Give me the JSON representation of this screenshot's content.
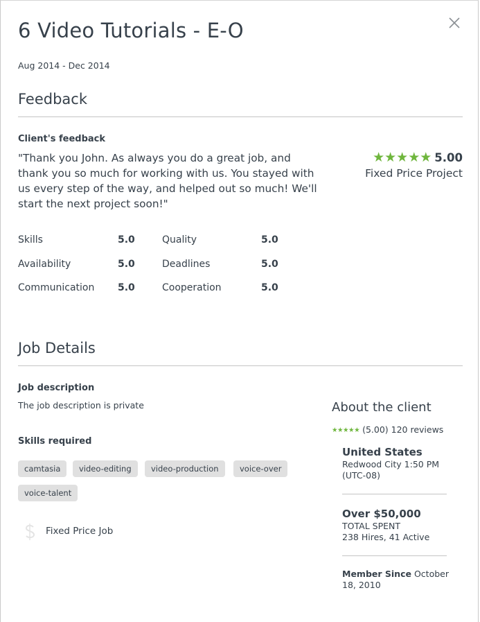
{
  "header": {
    "title": "6 Video Tutorials - E-O",
    "dates": "Aug 2014 - Dec 2014"
  },
  "feedback": {
    "section_title": "Feedback",
    "client_feedback_label": "Client's feedback",
    "quote": "\"Thank you John. As always you do a great job, and thank you so much for working with us. You stayed with us every step of the way, and helped out so much! We'll start the next project soon!\"",
    "stars": "★★★★★",
    "overall_score": "5.00",
    "rating_value": 5.0,
    "contract_type": "Fixed Price Project",
    "metrics": [
      {
        "label": "Skills",
        "value": "5.0"
      },
      {
        "label": "Quality",
        "value": "5.0"
      },
      {
        "label": "Availability",
        "value": "5.0"
      },
      {
        "label": "Deadlines",
        "value": "5.0"
      },
      {
        "label": "Communication",
        "value": "5.0"
      },
      {
        "label": "Cooperation",
        "value": "5.0"
      }
    ]
  },
  "job_details": {
    "section_title": "Job Details",
    "description_label": "Job description",
    "description": "The job description is private",
    "skills_label": "Skills required",
    "skills": [
      "camtasia",
      "video-editing",
      "video-production",
      "voice-over",
      "voice-talent"
    ],
    "job_type": "Fixed Price Job"
  },
  "about_client": {
    "title": "About the client",
    "stars": "★★★★★",
    "rating": "(5.00) 120 reviews",
    "location": "United States",
    "city_time": "Redwood City 1:50 PM",
    "timezone": "(UTC-08)",
    "spent": "Over $50,000",
    "spent_label": "TOTAL SPENT",
    "hires": "238 Hires, 41 Active",
    "member_since_label": "Member Since",
    "member_since": "October 18, 2010"
  },
  "colors": {
    "star_green": "#6fb63d",
    "text": "#37414b",
    "tag_bg": "#e0e0e0",
    "divider": "#c4c4c4"
  },
  "icons": {
    "close": "close-icon",
    "star": "star-icon",
    "fixed_price": "fixed-price-icon"
  }
}
